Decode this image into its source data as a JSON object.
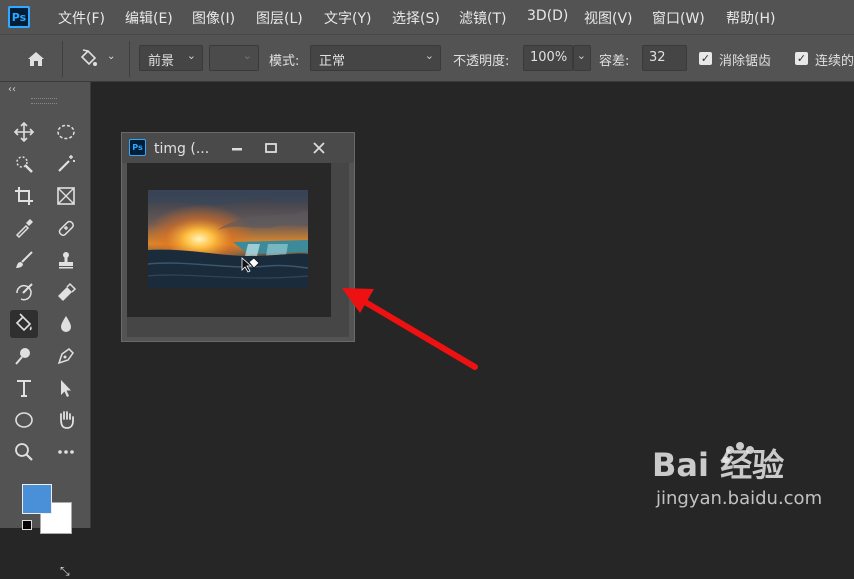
{
  "menubar": {
    "logo": "Ps",
    "items": [
      "文件(F)",
      "编辑(E)",
      "图像(I)",
      "图层(L)",
      "文字(Y)",
      "选择(S)",
      "滤镜(T)",
      "3D(D)",
      "视图(V)",
      "窗口(W)",
      "帮助(H)"
    ]
  },
  "options": {
    "fill_source": "前景",
    "pattern_value": "",
    "mode_label": "模式:",
    "mode_value": "正常",
    "opacity_label": "不透明度:",
    "opacity_value": "100%",
    "tolerance_label": "容差:",
    "tolerance_value": "32",
    "antialias_label": "消除锯齿",
    "antialias_checked": true,
    "contiguous_label": "连续的",
    "contiguous_checked": true
  },
  "toolbar": {
    "active_tool": "paint-bucket",
    "foreground_color": "#4a90d9",
    "background_color": "#ffffff",
    "tools": [
      "move-icon",
      "marquee-ellipse-icon",
      "quick-selection-icon",
      "magic-wand-icon",
      "crop-icon",
      "frame-icon",
      "eyedropper-icon",
      "healing-brush-icon",
      "brush-icon",
      "clone-stamp-icon",
      "history-brush-icon",
      "eraser-icon",
      "paint-bucket-icon",
      "blur-icon",
      "dodge-icon",
      "pen-icon",
      "type-icon",
      "path-selection-icon",
      "ellipse-shape-icon",
      "hand-icon",
      "zoom-icon",
      "more-tools-icon"
    ]
  },
  "document": {
    "logo": "Ps",
    "title": "timg (..."
  },
  "watermark": {
    "brand": "Bai 经验",
    "url": "jingyan.baidu.com"
  },
  "colors": {
    "accent_arrow": "#ee1111",
    "ps_blue": "#31a8ff"
  }
}
